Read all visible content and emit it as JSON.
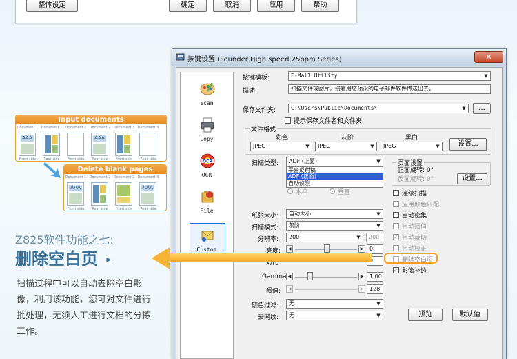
{
  "top_dialog": {
    "global_settings_button": "整体设定",
    "ok_button": "确定",
    "cancel_button": "取消",
    "apply_button": "应用",
    "help_button": "帮助"
  },
  "diagram": {
    "input_title": "Input documents",
    "output_title": "Delete blank pages",
    "input_pages": [
      {
        "label": "Document 1",
        "side": "Front side"
      },
      {
        "label": "Document 1",
        "side": "Rear side"
      },
      {
        "label": "Document 2",
        "side": "Front side"
      },
      {
        "label": "Document 2",
        "side": "Rear side"
      },
      {
        "label": "Document 3",
        "side": "Front side"
      },
      {
        "label": "Document 3",
        "side": "Rear side"
      }
    ],
    "output_pages": [
      {
        "label": "Document 1",
        "side": "Front side"
      },
      {
        "label": "Document 2",
        "side": "Rear side"
      },
      {
        "label": "Document 2",
        "side": "Front side"
      },
      {
        "label": "Document 3",
        "side": "Rear side"
      }
    ],
    "sample_text": "AAA",
    "colors": {
      "title_bar": "#e68a1c",
      "arrow": "#4fa3d8"
    }
  },
  "feature": {
    "line1": "Z825软件功能之七:",
    "title": "删除空白页",
    "title_arrow": "▸",
    "description": "扫描过程中可以自动去除空白影像，利用该功能，您可对文件进行批处理，无须人工进行文档的分拣工作。"
  },
  "window": {
    "title": "按键设置 (Founder High speed 25ppm Series)",
    "close_glyph": "✕",
    "sidebar": [
      {
        "label": "Scan",
        "icon": "scan-icon"
      },
      {
        "label": "Copy",
        "icon": "printer-icon"
      },
      {
        "label": "OCR",
        "icon": "ocr-icon"
      },
      {
        "label": "File",
        "icon": "file-icon"
      },
      {
        "label": "Custom",
        "icon": "custom-icon",
        "selected": true
      }
    ],
    "template_label": "按键模板:",
    "template_value": "E-Mail Utility",
    "desc_label": "描述:",
    "desc_value": "扫描文件或图片，接着用您预设的电子邮件软件传送出去。",
    "save_folder_label": "保存文件夹:",
    "save_folder_value": "C:\\Users\\Public\\Documents\\",
    "browse_button": "...",
    "prompt_checkbox": "提示保存文件名和文件夹",
    "file_format_group": "文件格式",
    "format_columns": [
      "彩色",
      "灰阶",
      "黑白"
    ],
    "format_values": [
      "JPEG",
      "JPEG",
      "JPEG"
    ],
    "format_settings_button": "设置...",
    "scan_type_label": "扫描类型:",
    "scan_type_value": "ADF (正面)",
    "scan_type_options": [
      "平台反射稿",
      "ADF (正面)",
      "自动侦测"
    ],
    "orientation_horizontal": "水平",
    "orientation_vertical": "垂直",
    "page_settings_group": "页面设置",
    "front_rotation": "正面旋转: 0°",
    "back_rotation": "反面旋转: 0°",
    "page_settings_button": "设置...",
    "paper_size_label": "纸张大小:",
    "paper_size_value": "自动大小",
    "scan_mode_label": "扫描模式:",
    "scan_mode_value": "灰阶",
    "resolution_label": "分辨率:",
    "resolution_value": "200",
    "resolution_alt": "200",
    "brightness_label": "亮度:",
    "brightness_value": "0",
    "contrast_label": "对比:",
    "contrast_value": "0",
    "gamma_label": "Gamma:",
    "gamma_value": "1.00",
    "threshold_label": "阈值:",
    "threshold_value": "128",
    "color_filter_label": "颜色过滤:",
    "color_filter_value": "无",
    "descreen_label": "去网纹:",
    "descreen_value": "无",
    "preview_button": "预览",
    "default_button": "默认值",
    "options": [
      {
        "label": "连续扫描",
        "checked": false,
        "disabled": false
      },
      {
        "label": "应用颜色匹配",
        "checked": false,
        "disabled": true
      },
      {
        "label": "自动密集",
        "checked": false,
        "disabled": false
      },
      {
        "label": "自动阈值",
        "checked": false,
        "disabled": true
      },
      {
        "label": "自动裁切",
        "checked": true,
        "disabled": true
      },
      {
        "label": "自动校正",
        "checked": false,
        "disabled": true
      },
      {
        "label": "删除空白页",
        "checked": false,
        "disabled": false
      },
      {
        "label": "影像补边",
        "checked": true,
        "disabled": false
      }
    ],
    "highlight_color": "#f0a220"
  }
}
